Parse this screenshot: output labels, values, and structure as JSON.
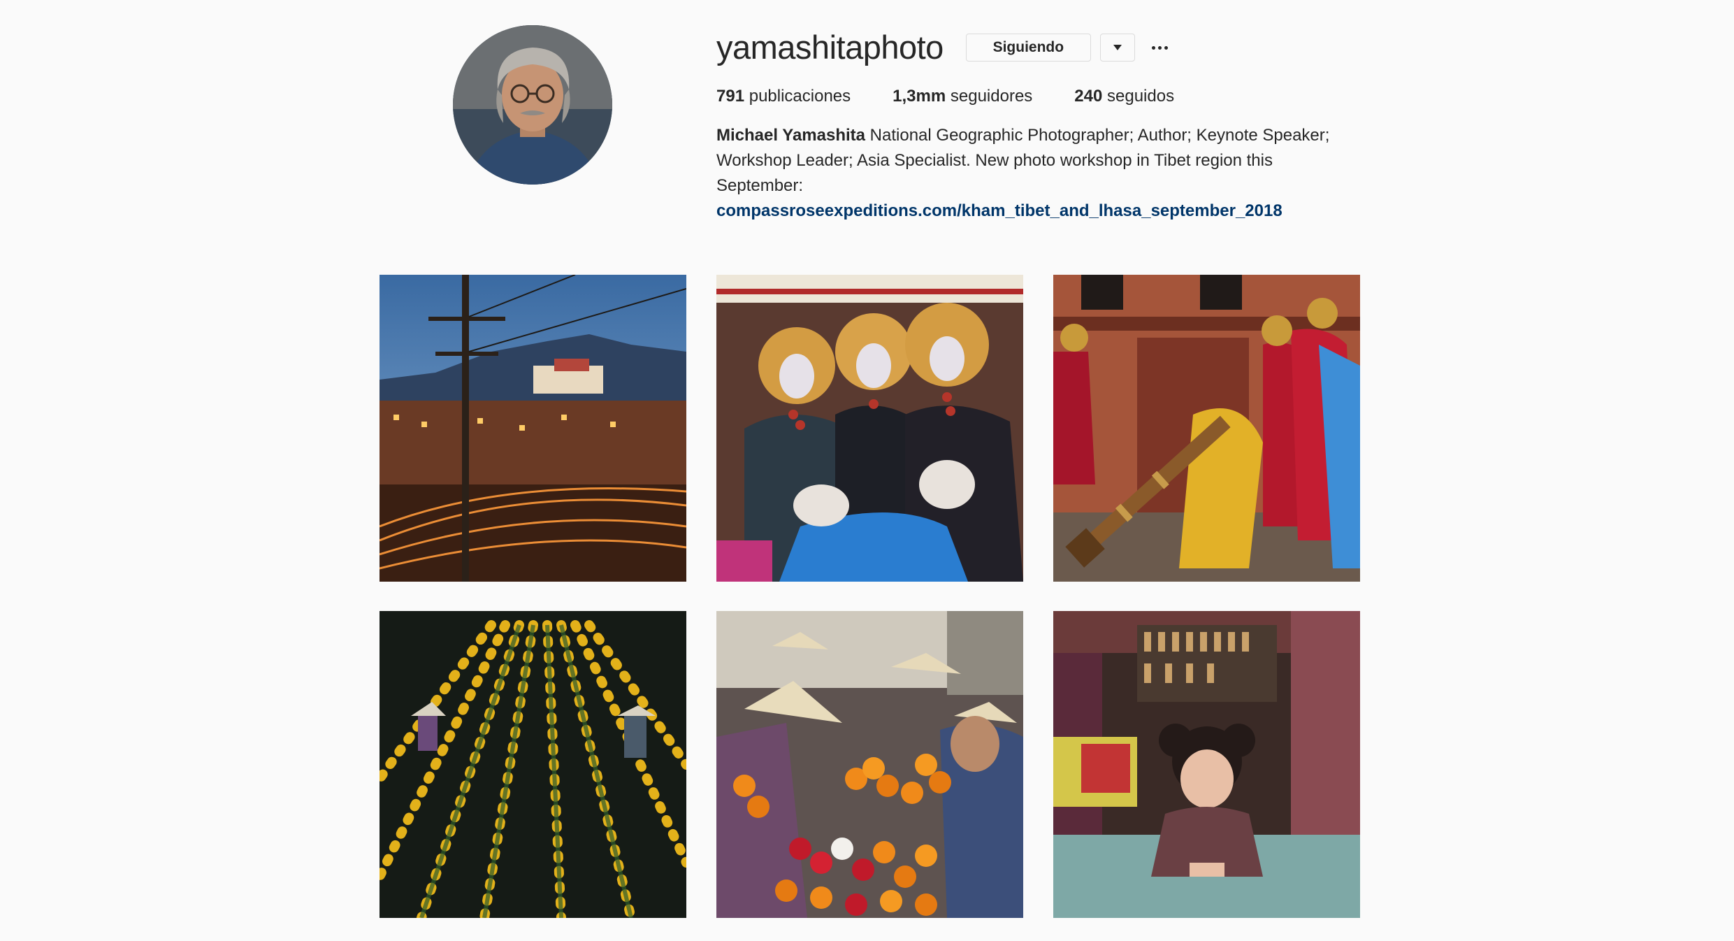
{
  "profile": {
    "username": "yamashitaphoto",
    "follow_label": "Siguiendo",
    "avatar_icon": "profile-photo",
    "stats": {
      "posts_count": "791",
      "posts_label": "publicaciones",
      "followers_count": "1,3mm",
      "followers_label": "seguidores",
      "following_count": "240",
      "following_label": "seguidos"
    },
    "bio": {
      "name": "Michael Yamashita",
      "text": "National Geographic Photographer; Author; Keynote Speaker; Workshop Leader; Asia Specialist. New photo workshop in Tibet region this September:",
      "link": "compassroseexpeditions.com/kham_tibet_and_lhasa_september_2018"
    }
  },
  "colors": {
    "background": "#fafafa",
    "text": "#262626",
    "link": "#003569",
    "border": "#dbdbdb"
  },
  "posts": [
    {
      "subject": "lhasa-street-at-dusk"
    },
    {
      "subject": "tibetan-women-fur-hats"
    },
    {
      "subject": "monks-with-long-horn"
    },
    {
      "subject": "marigold-fields"
    },
    {
      "subject": "flower-market-conical-hats"
    },
    {
      "subject": "child-in-shop"
    }
  ]
}
